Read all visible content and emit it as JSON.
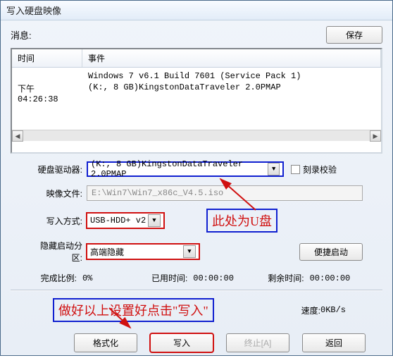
{
  "window": {
    "title": "写入硬盘映像"
  },
  "msg": {
    "label": "消息:",
    "save_btn": "保存"
  },
  "log": {
    "col_time": "时间",
    "col_event": "事件",
    "rows": [
      {
        "time": "",
        "event": "Windows 7 v6.1 Build 7601 (Service Pack 1)"
      },
      {
        "time": "下午 04:26:38",
        "event": "(K:, 8 GB)KingstonDataTraveler 2.0PMAP"
      }
    ]
  },
  "form": {
    "drive_label": "硬盘驱动器:",
    "drive_value": "(K:, 8 GB)KingstonDataTraveler 2.0PMAP",
    "verify_label": "刻录校验",
    "image_label": "映像文件:",
    "image_value": "E:\\Win7\\Win7_x86c_V4.5.iso",
    "mode_label": "写入方式:",
    "mode_value": "USB-HDD+ v2",
    "hidden_label": "隐藏启动分区:",
    "hidden_value": "高端隐藏",
    "convenient_btn": "便捷启动"
  },
  "status": {
    "progress_label": "完成比例:",
    "progress_value": "0%",
    "elapsed_label": "已用时间:",
    "elapsed_value": "00:00:00",
    "remain_label": "剩余时间:",
    "remain_value": "00:00:00",
    "speed_label": "速度:",
    "speed_value": "0KB/s"
  },
  "annotations": {
    "drive_note": "此处为U盘",
    "write_note": "做好以上设置好点击\"写入\""
  },
  "buttons": {
    "format": "格式化",
    "write": "写入",
    "abort": "终止[A]",
    "back": "返回"
  }
}
